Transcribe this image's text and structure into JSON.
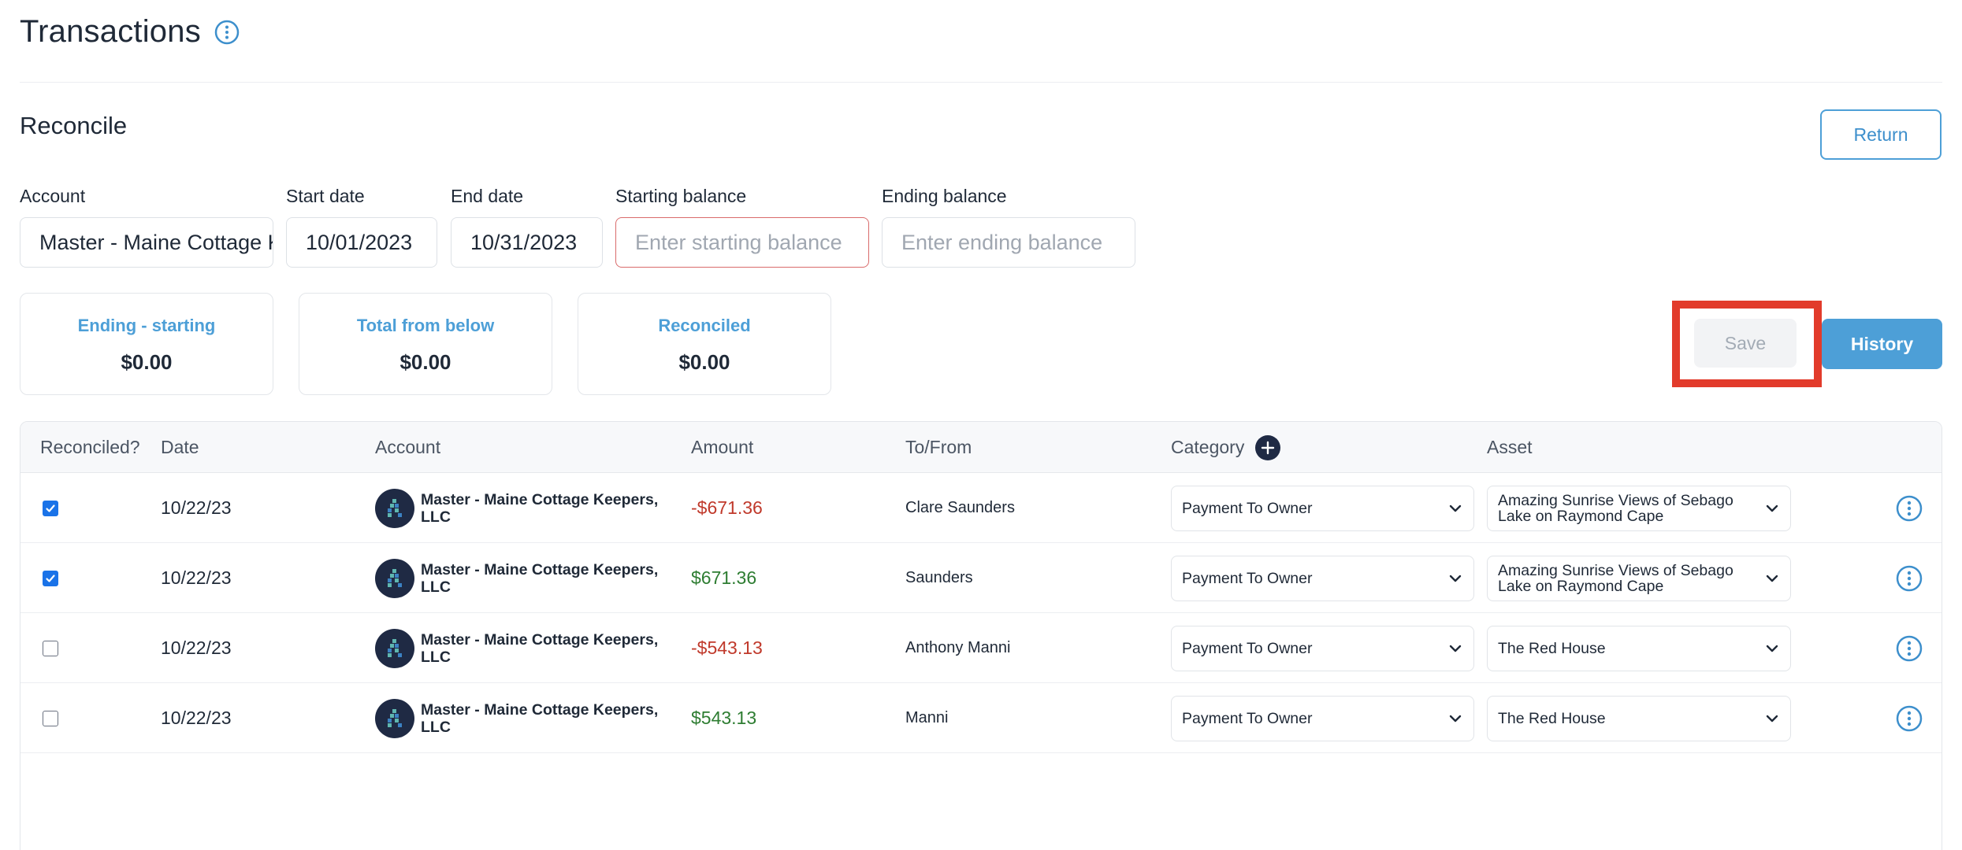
{
  "page": {
    "title": "Transactions"
  },
  "reconcile": {
    "section_title": "Reconcile",
    "return_label": "Return",
    "account": {
      "label": "Account",
      "value": "Master - Maine Cottage Keepers, LLC"
    },
    "start_date": {
      "label": "Start date",
      "value": "10/01/2023"
    },
    "end_date": {
      "label": "End date",
      "value": "10/31/2023"
    },
    "starting_balance": {
      "label": "Starting balance",
      "placeholder": "Enter starting balance"
    },
    "ending_balance": {
      "label": "Ending balance",
      "placeholder": "Enter ending balance"
    },
    "stats": [
      {
        "label": "Ending - starting",
        "value": "$0.00"
      },
      {
        "label": "Total from below",
        "value": "$0.00"
      },
      {
        "label": "Reconciled",
        "value": "$0.00"
      }
    ],
    "save_label": "Save",
    "history_label": "History"
  },
  "table": {
    "headers": {
      "reconciled": "Reconciled?",
      "date": "Date",
      "account": "Account",
      "amount": "Amount",
      "tofrom": "To/From",
      "category": "Category",
      "asset": "Asset"
    },
    "rows": [
      {
        "reconciled": true,
        "date": "10/22/23",
        "account": "Master - Maine Cottage Keepers, LLC",
        "amount": "-$671.36",
        "amount_sign": "neg",
        "tofrom": "Clare Saunders",
        "category": "Payment To Owner",
        "asset": "Amazing Sunrise Views of Sebago Lake on Raymond Cape"
      },
      {
        "reconciled": true,
        "date": "10/22/23",
        "account": "Master - Maine Cottage Keepers, LLC",
        "amount": "$671.36",
        "amount_sign": "pos",
        "tofrom": "Saunders",
        "category": "Payment To Owner",
        "asset": "Amazing Sunrise Views of Sebago Lake on Raymond Cape"
      },
      {
        "reconciled": false,
        "date": "10/22/23",
        "account": "Master - Maine Cottage Keepers, LLC",
        "amount": "-$543.13",
        "amount_sign": "neg",
        "tofrom": "Anthony Manni",
        "category": "Payment To Owner",
        "asset": "The Red House"
      },
      {
        "reconciled": false,
        "date": "10/22/23",
        "account": "Master - Maine Cottage Keepers, LLC",
        "amount": "$543.13",
        "amount_sign": "pos",
        "tofrom": "Manni",
        "category": "Payment To Owner",
        "asset": "The Red House"
      }
    ]
  },
  "colors": {
    "accent": "#4d9fd7",
    "highlight": "#e23b2b",
    "negative": "#c0392b",
    "positive": "#2e7d32"
  },
  "icons": {
    "title": "info-circle-icon",
    "category_add": "plus-circle-icon",
    "avatar": "company-logo-icon",
    "select": "chevron-down-icon",
    "row_menu": "kebab-menu-icon"
  }
}
